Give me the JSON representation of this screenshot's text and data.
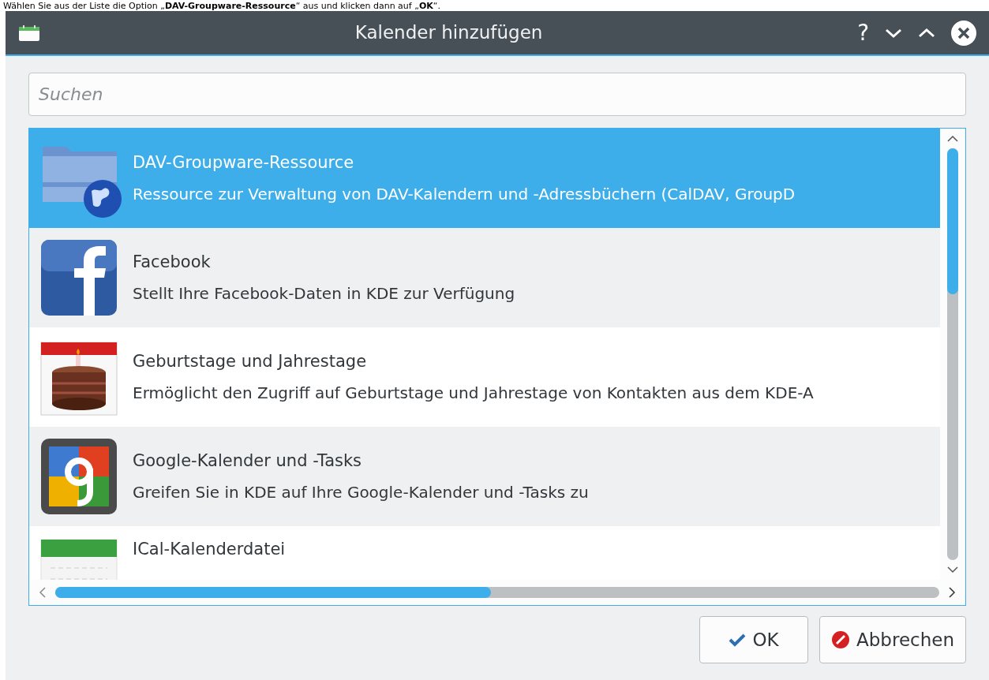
{
  "caption": "Wählen Sie aus der Liste die Option „**DAV-Groupware-Ressource**“ aus und klicken dann auf „**OK**“.",
  "window": {
    "title": "Kalender hinzufügen",
    "controls": [
      "?"
    ]
  },
  "search": {
    "placeholder": "Suchen"
  },
  "items": [
    {
      "kind": "dav",
      "title": "DAV-Groupware-Ressource",
      "description": "Ressource zur Verwaltung von DAV-Kalendern und -Adressbüchern (CalDAV, GroupD",
      "selected": true
    },
    {
      "kind": "facebook",
      "title": "Facebook",
      "description": "Stellt Ihre Facebook-Daten in KDE zur Verfügung",
      "selected": false
    },
    {
      "kind": "birthday",
      "title": "Geburtstage und Jahrestage",
      "description": "Ermöglicht den Zugriff auf Geburtstage und Jahrestage von Kontakten aus dem KDE-A",
      "selected": false
    },
    {
      "kind": "google",
      "title": "Google-Kalender und -Tasks",
      "description": "Greifen Sie in KDE auf Ihre Google-Kalender und -Tasks zu",
      "selected": false
    },
    {
      "kind": "ical",
      "title": "ICal-Kalenderdatei",
      "selected": false
    }
  ],
  "buttons": [
    {
      "kind": "ok",
      "label": "OK"
    },
    {
      "kind": "cancel",
      "label": "Abbrechen"
    }
  ]
}
